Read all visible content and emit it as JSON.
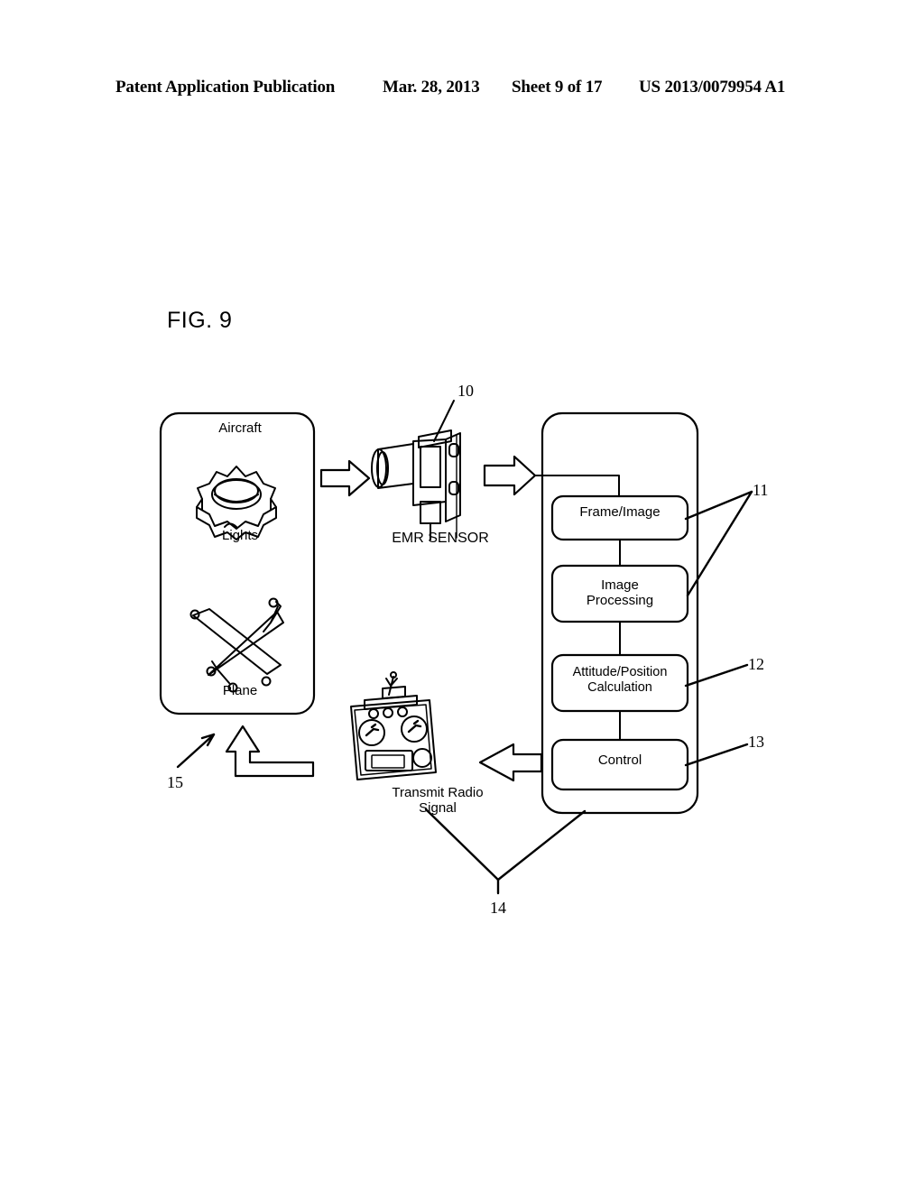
{
  "header": {
    "publication": "Patent Application Publication",
    "date": "Mar. 28, 2013",
    "sheet": "Sheet 9 of 17",
    "patent_number": "US 2013/0079954 A1"
  },
  "figure": {
    "label": "FIG. 9"
  },
  "aircraft_box": {
    "title": "Aircraft",
    "lights_label": "Lights",
    "plane_label": "Plane"
  },
  "sensor": {
    "label": "EMR SENSOR"
  },
  "transmitter": {
    "label": "Transmit Radio\nSignal"
  },
  "process_blocks": [
    {
      "label": "Frame/Image"
    },
    {
      "label": "Image\nProcessing"
    },
    {
      "label": "Attitude/Position\nCalculation"
    },
    {
      "label": "Control"
    }
  ],
  "reference_numerals": [
    {
      "id": "10",
      "value": "10",
      "refers_to": "emr-sensor"
    },
    {
      "id": "11",
      "value": "11",
      "refers_to": "frame-image-and-image-processing"
    },
    {
      "id": "12",
      "value": "12",
      "refers_to": "attitude-position-calculation"
    },
    {
      "id": "13",
      "value": "13",
      "refers_to": "control"
    },
    {
      "id": "14",
      "value": "14",
      "refers_to": "transmit-radio-signal-and-processor"
    },
    {
      "id": "15",
      "value": "15",
      "refers_to": "feedback-loop"
    }
  ],
  "colors": {
    "ink": "#000000",
    "paper": "#ffffff"
  }
}
